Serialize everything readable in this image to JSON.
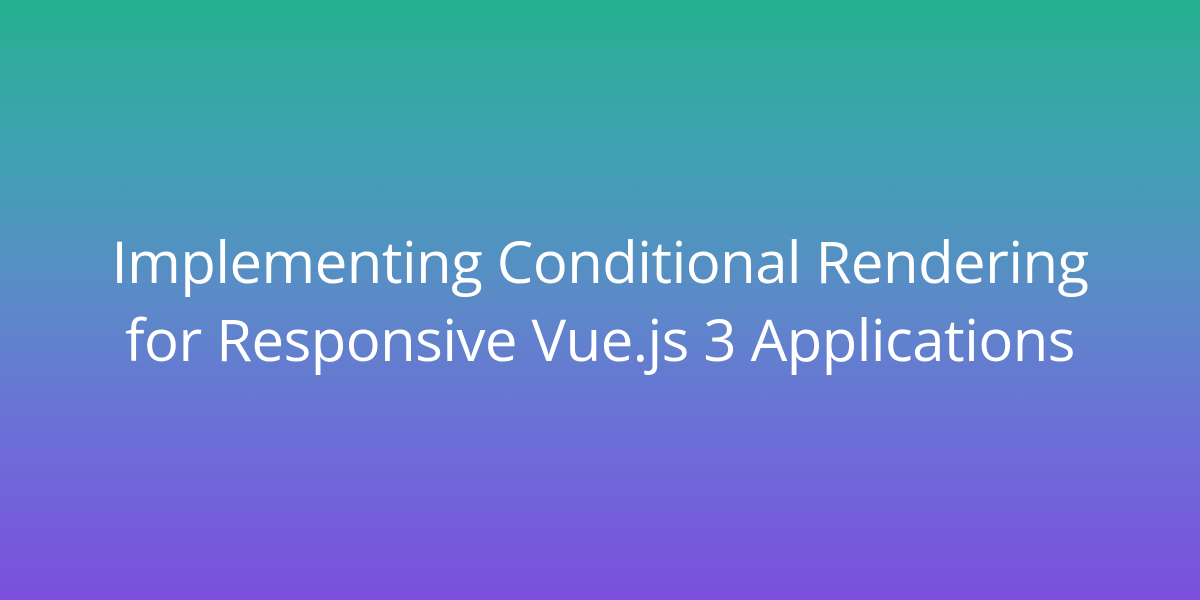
{
  "hero": {
    "title": "Implementing Conditional Rendering for Responsive Vue.js 3 Applications"
  },
  "colors": {
    "gradient_top": "#25b08f",
    "gradient_bottom": "#7a4fdc",
    "text": "#ffffff"
  }
}
